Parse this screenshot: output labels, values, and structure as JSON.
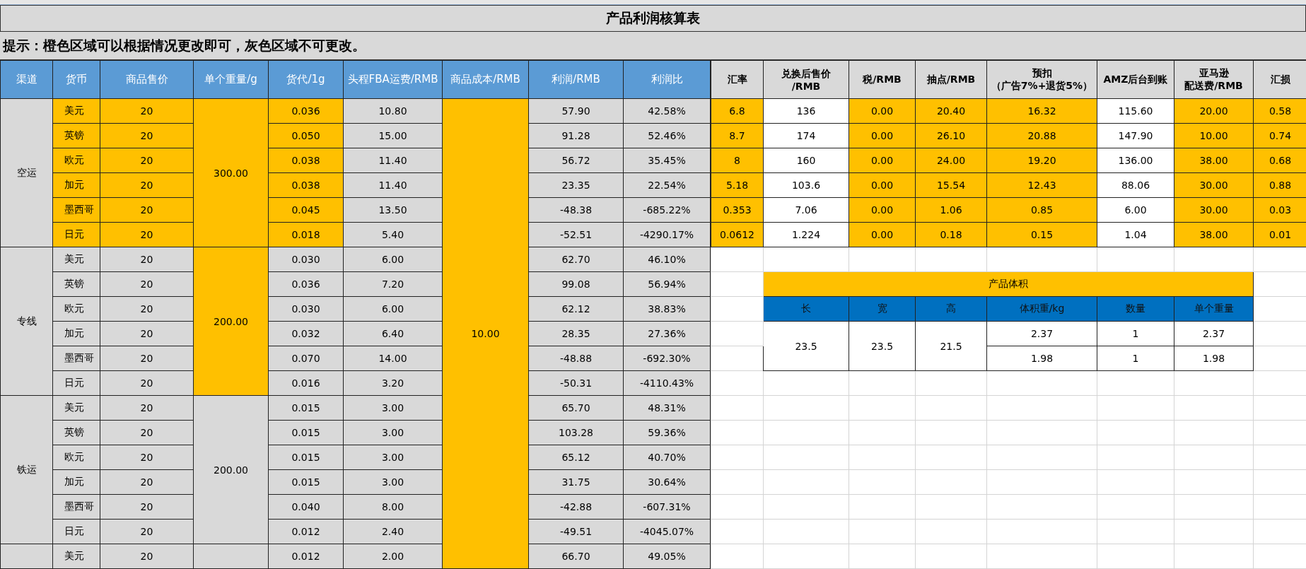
{
  "title": "产品利润核算表",
  "hint": "提示：橙色区域可以根据情况更改即可，灰色区域不可更改。",
  "columns": [
    "渠道",
    "货币",
    "商品售价",
    "单个重量/g",
    "货代/1g",
    "头程FBA运费/RMB",
    "商品成本/RMB",
    "利润/RMB",
    "利润比"
  ],
  "cost": "10.00",
  "groups": [
    {
      "channel": "空运",
      "editable": true,
      "weight_editable": true,
      "weight": "300.00",
      "rows": [
        {
          "currency": "美元",
          "price": "20",
          "rate": "0.036",
          "fba": "10.80",
          "profit": "57.90",
          "ratio": "42.58%"
        },
        {
          "currency": "英镑",
          "price": "20",
          "rate": "0.050",
          "fba": "15.00",
          "profit": "91.28",
          "ratio": "52.46%"
        },
        {
          "currency": "欧元",
          "price": "20",
          "rate": "0.038",
          "fba": "11.40",
          "profit": "56.72",
          "ratio": "35.45%"
        },
        {
          "currency": "加元",
          "price": "20",
          "rate": "0.038",
          "fba": "11.40",
          "profit": "23.35",
          "ratio": "22.54%"
        },
        {
          "currency": "墨西哥",
          "price": "20",
          "rate": "0.045",
          "fba": "13.50",
          "profit": "-48.38",
          "ratio": "-685.22%"
        },
        {
          "currency": "日元",
          "price": "20",
          "rate": "0.018",
          "fba": "5.40",
          "profit": "-52.51",
          "ratio": "-4290.17%"
        }
      ]
    },
    {
      "channel": "专线",
      "editable": false,
      "weight_editable": true,
      "weight": "200.00",
      "rows": [
        {
          "currency": "美元",
          "price": "20",
          "rate": "0.030",
          "fba": "6.00",
          "profit": "62.70",
          "ratio": "46.10%"
        },
        {
          "currency": "英镑",
          "price": "20",
          "rate": "0.036",
          "fba": "7.20",
          "profit": "99.08",
          "ratio": "56.94%"
        },
        {
          "currency": "欧元",
          "price": "20",
          "rate": "0.030",
          "fba": "6.00",
          "profit": "62.12",
          "ratio": "38.83%"
        },
        {
          "currency": "加元",
          "price": "20",
          "rate": "0.032",
          "fba": "6.40",
          "profit": "28.35",
          "ratio": "27.36%"
        },
        {
          "currency": "墨西哥",
          "price": "20",
          "rate": "0.070",
          "fba": "14.00",
          "profit": "-48.88",
          "ratio": "-692.30%"
        },
        {
          "currency": "日元",
          "price": "20",
          "rate": "0.016",
          "fba": "3.20",
          "profit": "-50.31",
          "ratio": "-4110.43%"
        }
      ]
    },
    {
      "channel": "铁运",
      "editable": false,
      "weight_editable": false,
      "weight": "200.00",
      "rows": [
        {
          "currency": "美元",
          "price": "20",
          "rate": "0.015",
          "fba": "3.00",
          "profit": "65.70",
          "ratio": "48.31%"
        },
        {
          "currency": "英镑",
          "price": "20",
          "rate": "0.015",
          "fba": "3.00",
          "profit": "103.28",
          "ratio": "59.36%"
        },
        {
          "currency": "欧元",
          "price": "20",
          "rate": "0.015",
          "fba": "3.00",
          "profit": "65.12",
          "ratio": "40.70%"
        },
        {
          "currency": "加元",
          "price": "20",
          "rate": "0.015",
          "fba": "3.00",
          "profit": "31.75",
          "ratio": "30.64%"
        },
        {
          "currency": "墨西哥",
          "price": "20",
          "rate": "0.040",
          "fba": "8.00",
          "profit": "-42.88",
          "ratio": "-607.31%"
        },
        {
          "currency": "日元",
          "price": "20",
          "rate": "0.012",
          "fba": "2.40",
          "profit": "-49.51",
          "ratio": "-4045.07%"
        }
      ]
    },
    {
      "editable": false,
      "weight_editable": false,
      "rows": [
        {
          "currency": "美元",
          "price": "20",
          "rate": "0.012",
          "fba": "2.00",
          "profit": "66.70",
          "ratio": "49.05%"
        }
      ]
    }
  ],
  "fx_columns": [
    {
      "label": [
        "汇率"
      ],
      "editable": true
    },
    {
      "label": [
        "兑换后售价",
        "/RMB"
      ],
      "editable": false
    },
    {
      "label": [
        "税/RMB"
      ],
      "editable": true
    },
    {
      "label": [
        "抽点/RMB"
      ],
      "editable": true
    },
    {
      "label": [
        "预扣",
        "（广告7%+退货5%）"
      ],
      "editable": true
    },
    {
      "label": [
        "AMZ后台到账"
      ],
      "editable": false
    },
    {
      "label": [
        "亚马逊",
        "配送费/RMB"
      ],
      "editable": true
    },
    {
      "label": [
        "汇损"
      ],
      "editable": true
    }
  ],
  "fx_rows": [
    [
      "6.8",
      "136",
      "0.00",
      "20.40",
      "16.32",
      "115.60",
      "20.00",
      "0.58"
    ],
    [
      "8.7",
      "174",
      "0.00",
      "26.10",
      "20.88",
      "147.90",
      "10.00",
      "0.74"
    ],
    [
      "8",
      "160",
      "0.00",
      "24.00",
      "19.20",
      "136.00",
      "38.00",
      "0.68"
    ],
    [
      "5.18",
      "103.6",
      "0.00",
      "15.54",
      "12.43",
      "88.06",
      "30.00",
      "0.88"
    ],
    [
      "0.353",
      "7.06",
      "0.00",
      "1.06",
      "0.85",
      "6.00",
      "30.00",
      "0.03"
    ],
    [
      "0.0612",
      "1.224",
      "0.00",
      "0.18",
      "0.15",
      "1.04",
      "38.00",
      "0.01"
    ]
  ],
  "volume": {
    "title": "产品体积",
    "columns": [
      "长",
      "宽",
      "高",
      "体积重/kg",
      "数量",
      "单个重量"
    ],
    "dims": [
      "23.5",
      "23.5",
      "21.5"
    ],
    "rows": [
      [
        "2.37",
        "1",
        "2.37"
      ],
      [
        "1.98",
        "1",
        "1.98"
      ]
    ]
  }
}
